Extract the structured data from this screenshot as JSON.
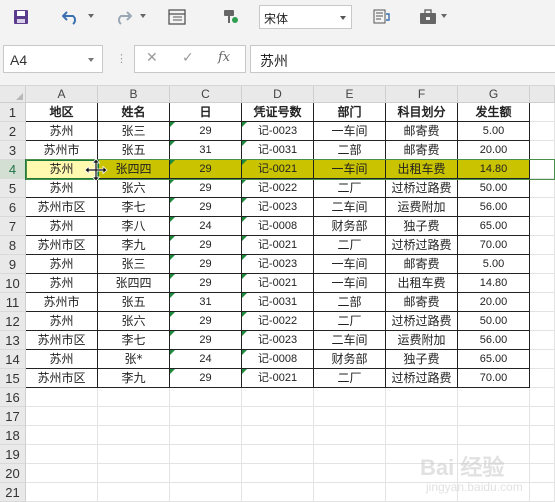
{
  "toolbar": {
    "font_name": "宋体"
  },
  "formula_bar": {
    "name_box": "A4",
    "more_label": "⋮",
    "cancel_label": "✕",
    "confirm_label": "✓",
    "fx_label": "fx",
    "formula": "苏州"
  },
  "columns": [
    "A",
    "B",
    "C",
    "D",
    "E",
    "F",
    "G"
  ],
  "rows": [
    {
      "num": "1",
      "cells": [
        "地区",
        "姓名",
        "日",
        "凭证号数",
        "部门",
        "科目划分",
        "发生额"
      ]
    },
    {
      "num": "2",
      "cells": [
        "苏州",
        "张三",
        "29",
        "记-0023",
        "一车间",
        "邮寄费",
        "5.00"
      ]
    },
    {
      "num": "3",
      "cells": [
        "苏州市",
        "张五",
        "31",
        "记-0031",
        "二部",
        "邮寄费",
        "20.00"
      ]
    },
    {
      "num": "4",
      "cells": [
        "苏州",
        "张四四",
        "29",
        "记-0021",
        "一车间",
        "出租车费",
        "14.80"
      ]
    },
    {
      "num": "5",
      "cells": [
        "苏州",
        "张六",
        "29",
        "记-0022",
        "二厂",
        "过桥过路费",
        "50.00"
      ]
    },
    {
      "num": "6",
      "cells": [
        "苏州市区",
        "李七",
        "29",
        "记-0023",
        "二车间",
        "运费附加",
        "56.00"
      ]
    },
    {
      "num": "7",
      "cells": [
        "苏州",
        "李八",
        "24",
        "记-0008",
        "财务部",
        "独子费",
        "65.00"
      ]
    },
    {
      "num": "8",
      "cells": [
        "苏州市区",
        "李九",
        "29",
        "记-0021",
        "二厂",
        "过桥过路费",
        "70.00"
      ]
    },
    {
      "num": "9",
      "cells": [
        "苏州",
        "张三",
        "29",
        "记-0023",
        "一车间",
        "邮寄费",
        "5.00"
      ]
    },
    {
      "num": "10",
      "cells": [
        "苏州",
        "张四四",
        "29",
        "记-0021",
        "一车间",
        "出租车费",
        "14.80"
      ]
    },
    {
      "num": "11",
      "cells": [
        "苏州市",
        "张五",
        "31",
        "记-0031",
        "二部",
        "邮寄费",
        "20.00"
      ]
    },
    {
      "num": "12",
      "cells": [
        "苏州",
        "张六",
        "29",
        "记-0022",
        "二厂",
        "过桥过路费",
        "50.00"
      ]
    },
    {
      "num": "13",
      "cells": [
        "苏州市区",
        "李七",
        "29",
        "记-0023",
        "二车间",
        "运费附加",
        "56.00"
      ]
    },
    {
      "num": "14",
      "cells": [
        "苏州",
        "张*",
        "24",
        "记-0008",
        "财务部",
        "独子费",
        "65.00"
      ]
    },
    {
      "num": "15",
      "cells": [
        "苏州市区",
        "李九",
        "29",
        "记-0021",
        "二厂",
        "过桥过路费",
        "70.00"
      ]
    },
    {
      "num": "16",
      "cells": []
    },
    {
      "num": "17",
      "cells": []
    },
    {
      "num": "18",
      "cells": []
    },
    {
      "num": "19",
      "cells": []
    },
    {
      "num": "20",
      "cells": []
    },
    {
      "num": "21",
      "cells": []
    }
  ],
  "watermark": {
    "text": "Bai 经验",
    "sub": "jingyan.baidu.com"
  },
  "colors": {
    "highlight": "#c9c300",
    "selected_cell": "#fff9b0",
    "accent": "#217346"
  }
}
